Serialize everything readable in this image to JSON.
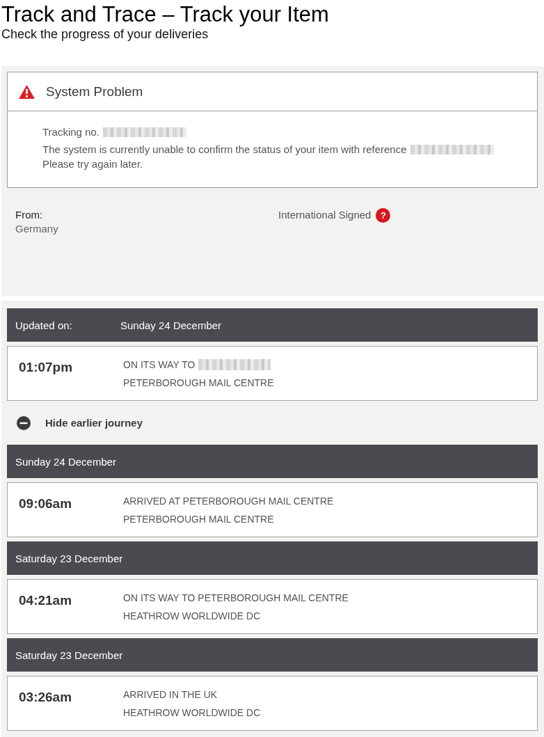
{
  "header": {
    "title": "Track and Trace – Track your Item",
    "subtitle": "Check the progress of your deliveries"
  },
  "alert": {
    "kind": "error",
    "title": "System Problem",
    "lines": [
      {
        "text": "Tracking no.",
        "redacted": true
      },
      {
        "text": "The system is currently unable to confirm the status of your item with reference",
        "redacted": true
      },
      {
        "text": "Please try again later.",
        "redacted": false
      }
    ]
  },
  "details": {
    "from_label": "From:",
    "from_value": "Germany",
    "service": "International Signed",
    "help_icon": "?"
  },
  "latest": {
    "label": "Updated on:",
    "date": "Sunday 24 December",
    "event": {
      "time": "01:07pm",
      "status": "ON ITS WAY TO",
      "redacted": true,
      "location": "PETERBOROUGH MAIL CENTRE"
    }
  },
  "journey_toggle": {
    "label": "Hide earlier journey",
    "expanded": true
  },
  "history": [
    {
      "date": "Sunday 24 December",
      "event": {
        "time": "09:06am",
        "status": "ARRIVED AT PETERBOROUGH MAIL CENTRE",
        "redacted": false,
        "location": "PETERBOROUGH MAIL CENTRE"
      }
    },
    {
      "date": "Saturday 23 December",
      "event": {
        "time": "04:21am",
        "status": "ON ITS WAY TO PETERBOROUGH MAIL CENTRE",
        "redacted": false,
        "location": "HEATHROW WORLDWIDE DC"
      }
    },
    {
      "date": "Saturday 23 December",
      "event": {
        "time": "03:26am",
        "status": "ARRIVED IN THE UK",
        "redacted": false,
        "location": "HEATHROW WORLDWIDE DC"
      }
    }
  ]
}
